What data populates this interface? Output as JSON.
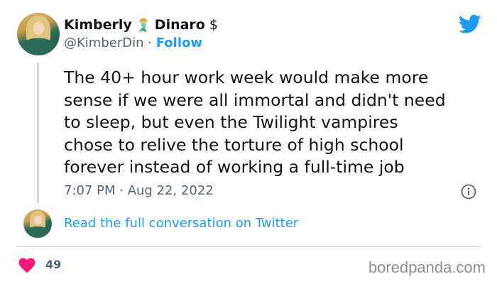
{
  "author": {
    "first_name": "Kimberly",
    "last_name": "Dinaro",
    "name_suffix": "$",
    "name_emoji": "mermaid-icon",
    "handle": "@KimberDin",
    "separator": "·",
    "follow_label": "Follow"
  },
  "tweet": {
    "lines": [
      "The 40+ hour work week would make more",
      "sense if we were all immortal and didn't need",
      "to sleep, but even the Twilight vampires",
      "chose to relive the torture of high school",
      "forever instead of working a full-time job"
    ],
    "timestamp": "7:07 PM · Aug 22, 2022"
  },
  "conversation": {
    "link_label": "Read the full conversation on Twitter"
  },
  "footer": {
    "like_count": "49",
    "watermark": "boredpanda.com"
  },
  "colors": {
    "accent": "#1d9bf0",
    "heart": "#f91880",
    "secondary_text": "#536471"
  }
}
